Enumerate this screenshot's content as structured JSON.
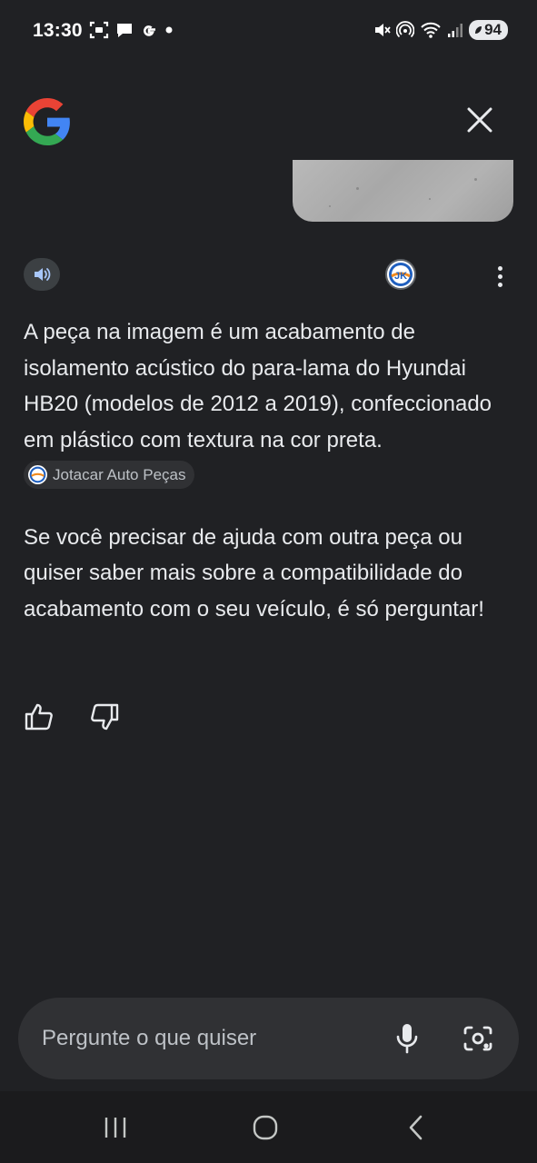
{
  "status_bar": {
    "time": "13:30",
    "battery": "94",
    "left_icons": [
      "screenshot-icon",
      "chat-bubble-icon",
      "google-g-icon",
      "dot-icon"
    ],
    "right_icons": [
      "mute-icon",
      "hotspot-icon",
      "wifi-icon",
      "signal-icon",
      "battery-icon"
    ]
  },
  "header": {
    "logo": "google-logo-icon",
    "close_icon": "close-icon"
  },
  "response": {
    "paragraph_1": "A peça na imagem é um acabamento de isolamento acústico do para-lama do Hyundai HB20 (modelos de 2012 a 2019), confeccionado em plástico com textura na cor preta.",
    "source_chip": "Jotacar Auto Peças",
    "source_logo_text": "JK",
    "paragraph_2": "Se você precisar de ajuda com outra peça ou quiser saber mais sobre a compatibilidade do acabamento com o seu veículo, é só perguntar!"
  },
  "input": {
    "placeholder": "Pergunte o que quiser"
  },
  "colors": {
    "background": "#202124",
    "surface": "#303134",
    "text": "#e8eaed",
    "muted_text": "#bdc1c6",
    "google_blue": "#4285F4",
    "google_red": "#EA4335",
    "google_yellow": "#FBBC05",
    "google_green": "#34A853"
  }
}
